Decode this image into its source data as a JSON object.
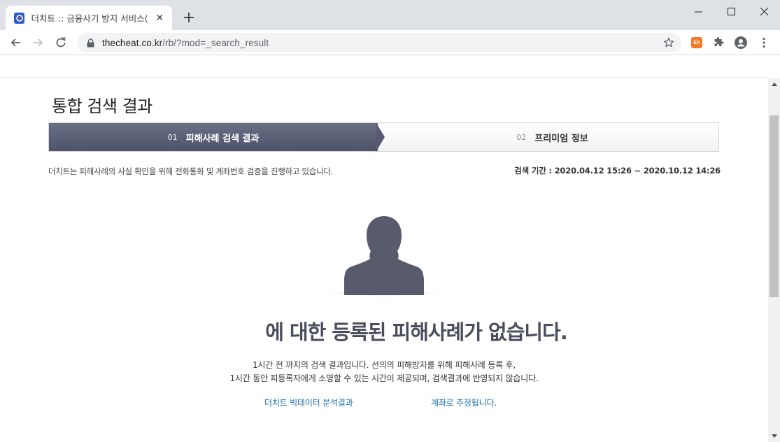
{
  "browser": {
    "tab_title": "더치트 :: 금융사기 방지 서비스(",
    "url_host": "thecheat.co.kr",
    "url_path": "/rb/?mod=_search_result",
    "ext_badge": "EX"
  },
  "page": {
    "title": "통합 검색 결과",
    "steps": [
      {
        "num": "01",
        "label": "피해사례 검색 결과",
        "active": true
      },
      {
        "num": "02",
        "label": "프리미엄 정보",
        "active": false
      }
    ],
    "notice": "더치트는 피해사례의 사실 확인을 위해 전화통화 및 계좌번호 검증을 진행하고 있습니다.",
    "period_label": "검색 기간 :",
    "period_value": "2020.04.12 15:26 ~ 2020.10.12 14:26",
    "headline": "에 대한 등록된 피해사례가 없습니다.",
    "sub_line1": "1시간 전 까지의 검색 결과입니다. 선의의 피해방지를 위해 피해사례 등록 후,",
    "sub_line2": "1시간 동안 피등록자에게 소명할 수 있는 시간이 제공되며, 검색결과에 반영되지 않습니다.",
    "link_bigdata": "더치트 빅데이터 분석결과",
    "link_account": "계좌로 추정됩니다."
  },
  "colors": {
    "step_active": "#565b71",
    "link": "#1a6fae",
    "headline": "#4a4d5c"
  }
}
